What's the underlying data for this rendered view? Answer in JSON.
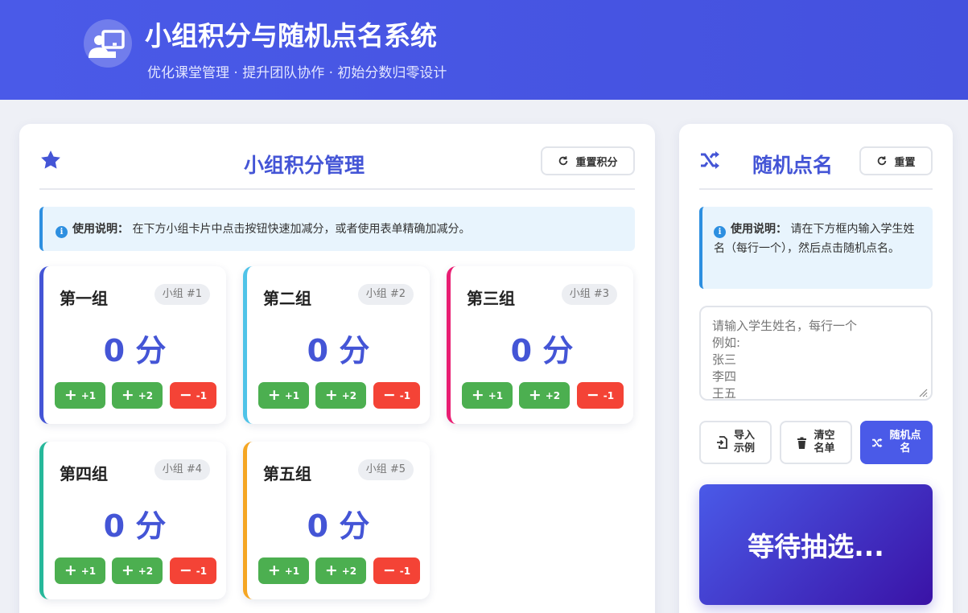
{
  "app": {
    "title": "小组积分与随机点名系统",
    "subtitle": "优化课堂管理 · 提升团队协作 · 初始分数归零设计"
  },
  "score_panel": {
    "title": "小组积分管理",
    "reset_label": "重置积分",
    "info_label": "使用说明：",
    "info_text": "在下方小组卡片中点击按钮快速加减分，或者使用表单精确加减分。",
    "plus1": "+1",
    "plus2": "+2",
    "minus1": "-1",
    "unit": "分",
    "groups": [
      {
        "name": "第一组",
        "badge": "小组 #1",
        "score": 0,
        "color": "#4455d6"
      },
      {
        "name": "第二组",
        "badge": "小组 #2",
        "score": 0,
        "color": "#4fc3e8"
      },
      {
        "name": "第三组",
        "badge": "小组 #3",
        "score": 0,
        "color": "#e91e73"
      },
      {
        "name": "第四组",
        "badge": "小组 #4",
        "score": 0,
        "color": "#26b89a"
      },
      {
        "name": "第五组",
        "badge": "小组 #5",
        "score": 0,
        "color": "#f5a623"
      }
    ]
  },
  "callout_panel": {
    "title": "随机点名",
    "reset_label": "重置",
    "info_label": "使用说明：",
    "info_text": "请在下方框内输入学生姓名（每行一个），然后点击随机点名。",
    "names_placeholder": "请输入学生姓名，每行一个\n例如:\n张三\n李四\n王五",
    "import_label": "导入\n示例",
    "clear_label": "清空\n名单",
    "pick_label": "随机点\n名",
    "result_text": "等待抽选..."
  },
  "colors": {
    "header": "#4a5ae8",
    "accent": "#4455d6",
    "green": "#4caf50",
    "red": "#f44336",
    "info": "#2d8fe0"
  }
}
